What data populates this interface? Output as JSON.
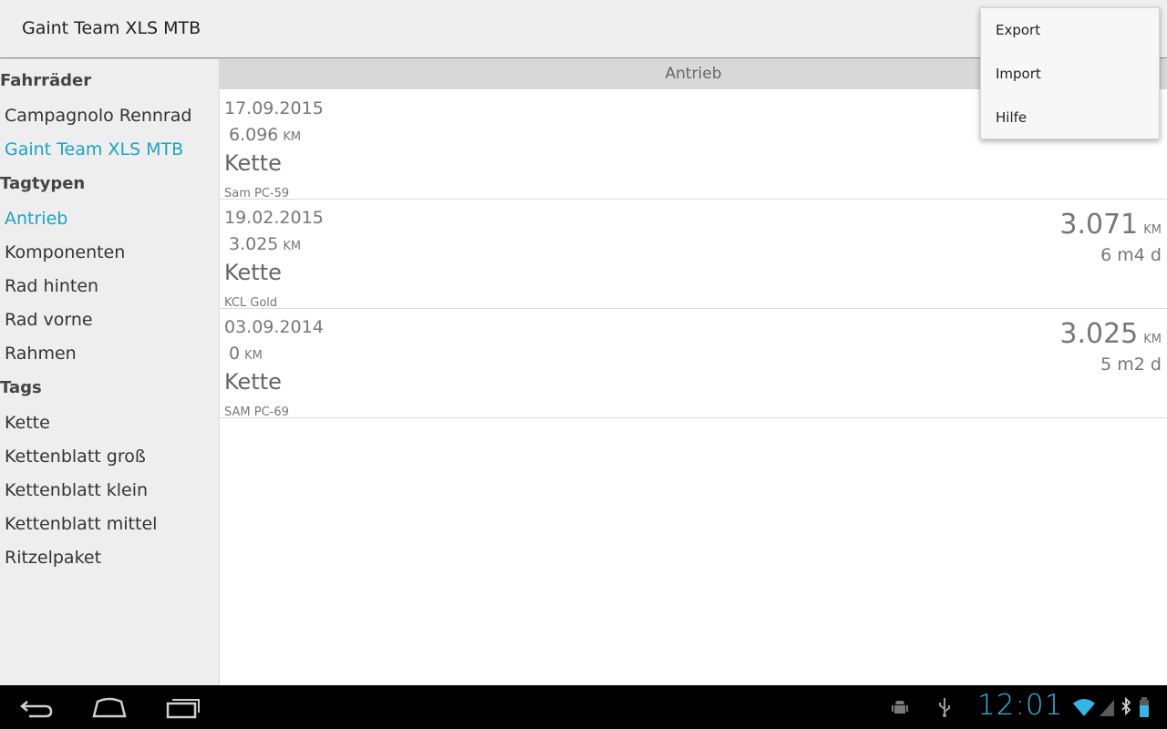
{
  "actionbar": {
    "title": "Gaint Team XLS MTB"
  },
  "menu": {
    "items": [
      "Export",
      "Import",
      "Hilfe"
    ]
  },
  "sidebar": {
    "sections": [
      {
        "header": "Fahrräder",
        "items": [
          {
            "label": "Campagnolo Rennrad",
            "active": false
          },
          {
            "label": "Gaint Team XLS MTB",
            "active": true
          }
        ]
      },
      {
        "header": "Tagtypen",
        "items": [
          {
            "label": "Antrieb",
            "active": true
          },
          {
            "label": "Komponenten",
            "active": false
          },
          {
            "label": "Rad hinten",
            "active": false
          },
          {
            "label": "Rad vorne",
            "active": false
          },
          {
            "label": "Rahmen",
            "active": false
          }
        ]
      },
      {
        "header": "Tags",
        "items": [
          {
            "label": "Kette",
            "active": false
          },
          {
            "label": "Kettenblatt groß",
            "active": false
          },
          {
            "label": "Kettenblatt klein",
            "active": false
          },
          {
            "label": "Kettenblatt mittel",
            "active": false
          },
          {
            "label": "Ritzelpaket",
            "active": false
          }
        ]
      }
    ]
  },
  "main": {
    "section_header": "Antrieb",
    "entries": [
      {
        "date": "17.09.2015",
        "km": "6.096",
        "km_unit": "KM",
        "tag": "Kette",
        "model": "Sam PC-59",
        "total": "",
        "total_unit": "",
        "age": ""
      },
      {
        "date": "19.02.2015",
        "km": "3.025",
        "km_unit": "KM",
        "tag": "Kette",
        "model": "KCL Gold",
        "total": "3.071",
        "total_unit": "KM",
        "age": "6 m4 d"
      },
      {
        "date": "03.09.2014",
        "km": "0",
        "km_unit": "KM",
        "tag": "Kette",
        "model": "SAM PC-69",
        "total": "3.025",
        "total_unit": "KM",
        "age": "5 m2 d"
      }
    ]
  },
  "system_bar": {
    "clock": "12:01",
    "nav_icons": [
      "back-icon",
      "home-icon",
      "recent-apps-icon"
    ],
    "status_icons": [
      "android-debug-icon",
      "usb-icon",
      "wifi-icon",
      "signal-icon",
      "bluetooth-icon",
      "battery-icon"
    ],
    "accent_color": "#33b5e5"
  },
  "colors": {
    "accent": "#1aa3c8",
    "actionbar_bg": "#efefef",
    "sidebar_bg": "#eeeeee",
    "section_header_bg": "#d8d8d8"
  }
}
